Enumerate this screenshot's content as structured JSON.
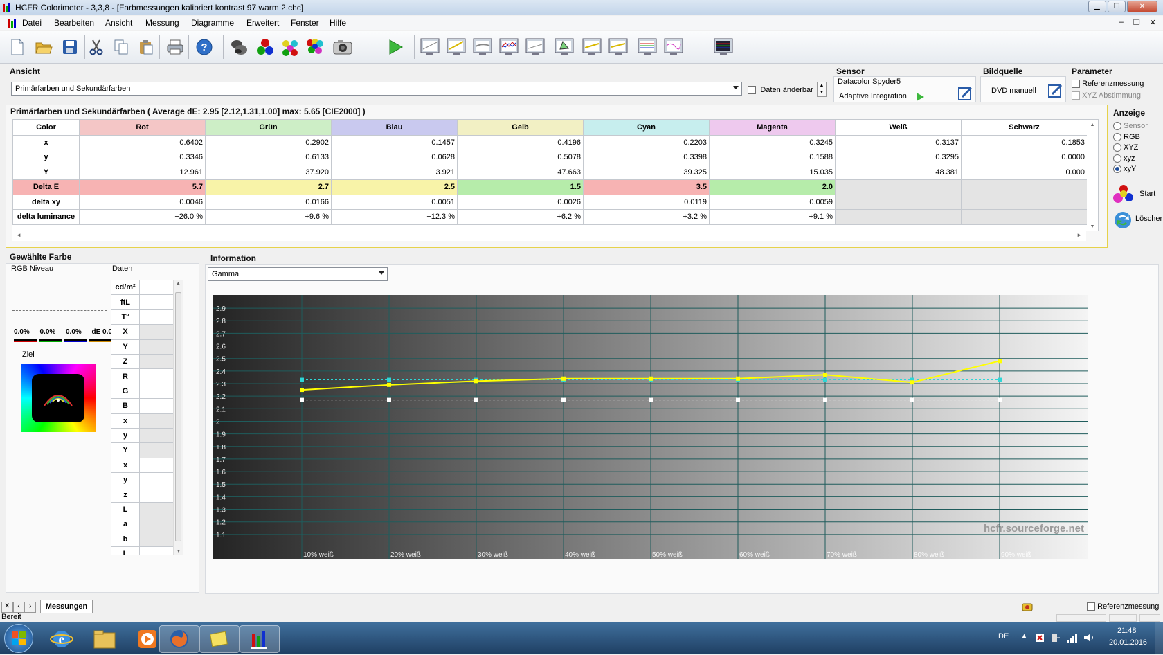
{
  "window": {
    "title": "HCFR Colorimeter - 3,3,8 - [Farbmessungen kalibriert kontrast 97 warm 2.chc]",
    "min": "▁",
    "max": "❐",
    "close": "✕"
  },
  "menu": [
    "Datei",
    "Bearbeiten",
    "Ansicht",
    "Messung",
    "Diagramme",
    "Erweitert",
    "Fenster",
    "Hilfe"
  ],
  "mdi_controls": {
    "min": "–",
    "restore": "❐",
    "close": "✕"
  },
  "ansicht": {
    "label": "Ansicht",
    "view_select": "Primärfarben und Sekundärfarben",
    "editable_label": "Daten änderbar"
  },
  "sensor": {
    "label": "Sensor",
    "device": "Datacolor Spyder5",
    "mode": "Adaptive Integration"
  },
  "bildquelle": {
    "label": "Bildquelle",
    "source": "DVD manuell"
  },
  "parameter": {
    "label": "Parameter",
    "referenz": "Referenzmessung",
    "xyz_abstimmung": "XYZ Abstimmung"
  },
  "measure": {
    "title": "Primärfarben und Sekundärfarben ( Average dE: 2.95 [2.12,1.31,1.00] max: 5.65 [CIE2000] )",
    "columns": [
      {
        "name": "Color",
        "color": "#ffffff"
      },
      {
        "name": "Rot",
        "color": "#f4c6c6"
      },
      {
        "name": "Grün",
        "color": "#cdeec6"
      },
      {
        "name": "Blau",
        "color": "#c9c9ef"
      },
      {
        "name": "Gelb",
        "color": "#f2f0c4"
      },
      {
        "name": "Cyan",
        "color": "#c7eeee"
      },
      {
        "name": "Magenta",
        "color": "#eec9ee"
      },
      {
        "name": "Weiß",
        "color": "#ffffff"
      },
      {
        "name": "Schwarz",
        "color": "#ffffff"
      }
    ],
    "rows": [
      {
        "label": "x",
        "values": [
          "0.6402",
          "0.2902",
          "0.1457",
          "0.4196",
          "0.2203",
          "0.3245",
          "0.3137",
          "0.1853"
        ]
      },
      {
        "label": "y",
        "values": [
          "0.3346",
          "0.6133",
          "0.0628",
          "0.5078",
          "0.3398",
          "0.1588",
          "0.3295",
          "0.0000"
        ]
      },
      {
        "label": "Y",
        "values": [
          "12.961",
          "37.920",
          "3.921",
          "47.663",
          "39.325",
          "15.035",
          "48.381",
          "0.000"
        ]
      },
      {
        "label": "Delta E",
        "values": [
          "5.7",
          "2.7",
          "2.5",
          "1.5",
          "3.5",
          "2.0",
          "",
          ""
        ],
        "colors": [
          "#f7b3b3",
          "#f8f3a8",
          "#f8f3a8",
          "#b6ecaa",
          "#f7b3b3",
          "#b6ecaa",
          "#e4e4e4",
          "#e4e4e4"
        ]
      },
      {
        "label": "delta xy",
        "values": [
          "0.0046",
          "0.0166",
          "0.0051",
          "0.0026",
          "0.0119",
          "0.0059",
          "",
          ""
        ]
      },
      {
        "label": "delta luminance",
        "values": [
          "+26.0 %",
          "+9.6 %",
          "+12.3 %",
          "+6.2 %",
          "+3.2 %",
          "+9.1 %",
          "",
          ""
        ]
      }
    ]
  },
  "anzeige": {
    "label": "Anzeige",
    "options": [
      "Sensor",
      "RGB",
      "XYZ",
      "xyz",
      "xyY"
    ],
    "selected": "xyY",
    "start": "Start",
    "delete": "Löscher"
  },
  "gewaehlte": {
    "label": "Gewählte Farbe",
    "rgb_label": "RGB Niveau",
    "daten_label": "Daten",
    "levels": [
      "0.0%",
      "0.0%",
      "0.0%",
      "dE 0.0"
    ],
    "ziel": "Ziel",
    "data_rows": [
      "cd/m²",
      "ftL",
      "T°",
      "X",
      "Y",
      "Z",
      "R",
      "G",
      "B",
      "x",
      "y",
      "Y",
      "x",
      "y",
      "z",
      "L",
      "a",
      "b",
      "L"
    ]
  },
  "information": {
    "label": "Information",
    "chart_select": "Gamma",
    "watermark": "hcfr.sourceforge.net"
  },
  "chart_data": {
    "type": "line",
    "ylabel": "",
    "y_ticks": [
      "2.9",
      "2.8",
      "2.7",
      "2.6",
      "2.5",
      "2.4",
      "2.3",
      "2.2",
      "2.1",
      "2",
      "1.9",
      "1.8",
      "1.7",
      "1.6",
      "1.5",
      "1.4",
      "1.3",
      "1.2",
      "1.1"
    ],
    "ylim": [
      1.0,
      2.95
    ],
    "x": [
      10,
      20,
      30,
      40,
      50,
      60,
      70,
      80,
      90
    ],
    "x_labels": [
      "10% weiß",
      "20% weiß",
      "30% weiß",
      "40% weiß",
      "50% weiß",
      "60% weiß",
      "70% weiß",
      "80% weiß",
      "90% weiß"
    ],
    "series": [
      {
        "color": "#ffff00",
        "values": [
          2.25,
          2.29,
          2.32,
          2.34,
          2.34,
          2.34,
          2.37,
          2.31,
          2.48
        ]
      },
      {
        "color": "#2fd6d6",
        "values": [
          2.33,
          2.33,
          2.33,
          2.33,
          2.33,
          2.33,
          2.33,
          2.33,
          2.33
        ]
      },
      {
        "color": "#ffffff",
        "values": [
          2.17,
          2.17,
          2.17,
          2.17,
          2.17,
          2.17,
          2.17,
          2.17,
          2.17
        ]
      }
    ],
    "grid": true
  },
  "tabs": {
    "label": "Messungen"
  },
  "bottom_right": {
    "referenz": "Referenzmessung"
  },
  "status": {
    "text": "Bereit"
  },
  "taskbar": {
    "lang": "DE",
    "time": "21:48",
    "date": "20.01.2016"
  }
}
